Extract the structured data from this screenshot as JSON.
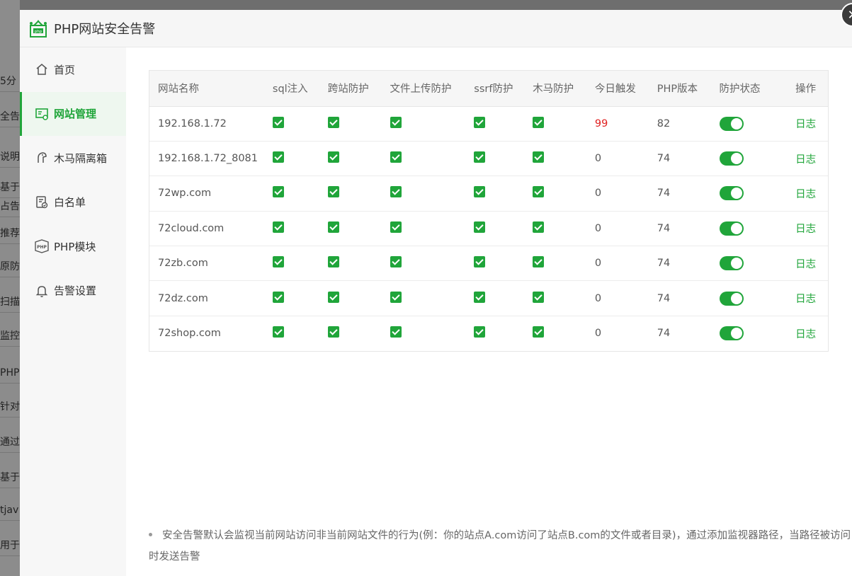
{
  "background": {
    "items": [
      "5分",
      "全告",
      "说明",
      "基于F",
      "占告警",
      "推荐:",
      "原防护",
      "扫描服",
      "监控网",
      "PHP",
      "针对C",
      "通过网",
      "基于E",
      "tjav",
      "用于监"
    ]
  },
  "modal": {
    "title": "PHP网站安全告警",
    "close_label": "✕"
  },
  "sidebar": {
    "items": [
      {
        "label": "首页",
        "icon": "home-icon"
      },
      {
        "label": "网站管理",
        "icon": "site-manage-icon"
      },
      {
        "label": "木马隔离箱",
        "icon": "trojan-isolation-icon"
      },
      {
        "label": "白名单",
        "icon": "whitelist-icon"
      },
      {
        "label": "PHP模块",
        "icon": "php-module-icon"
      },
      {
        "label": "告警设置",
        "icon": "bell-icon"
      }
    ],
    "active_index": 1
  },
  "table": {
    "headers": [
      "网站名称",
      "sql注入",
      "跨站防护",
      "文件上传防护",
      "ssrf防护",
      "木马防护",
      "今日触发",
      "PHP版本",
      "防护状态",
      "操作"
    ],
    "rows": [
      {
        "name": "192.168.1.72",
        "sql": true,
        "xss": true,
        "upload": true,
        "ssrf": true,
        "trojan": true,
        "today": "99",
        "php": "82",
        "enabled": true,
        "action": "日志"
      },
      {
        "name": "192.168.1.72_8081",
        "sql": true,
        "xss": true,
        "upload": true,
        "ssrf": true,
        "trojan": true,
        "today": "0",
        "php": "74",
        "enabled": true,
        "action": "日志"
      },
      {
        "name": "72wp.com",
        "sql": true,
        "xss": true,
        "upload": true,
        "ssrf": true,
        "trojan": true,
        "today": "0",
        "php": "74",
        "enabled": true,
        "action": "日志"
      },
      {
        "name": "72cloud.com",
        "sql": true,
        "xss": true,
        "upload": true,
        "ssrf": true,
        "trojan": true,
        "today": "0",
        "php": "74",
        "enabled": true,
        "action": "日志"
      },
      {
        "name": "72zb.com",
        "sql": true,
        "xss": true,
        "upload": true,
        "ssrf": true,
        "trojan": true,
        "today": "0",
        "php": "74",
        "enabled": true,
        "action": "日志"
      },
      {
        "name": "72dz.com",
        "sql": true,
        "xss": true,
        "upload": true,
        "ssrf": true,
        "trojan": true,
        "today": "0",
        "php": "74",
        "enabled": true,
        "action": "日志"
      },
      {
        "name": "72shop.com",
        "sql": true,
        "xss": true,
        "upload": true,
        "ssrf": true,
        "trojan": true,
        "today": "0",
        "php": "74",
        "enabled": true,
        "action": "日志"
      }
    ]
  },
  "note": {
    "text": "安全告警默认会监视当前网站访问非当前网站文件的行为(例：你的站点A.com访问了站点B.com的文件或者目录)，通过添加监视器路径，当路径被访问时发送告警"
  },
  "colors": {
    "accent": "#20a53a",
    "alert": "#e02020"
  }
}
